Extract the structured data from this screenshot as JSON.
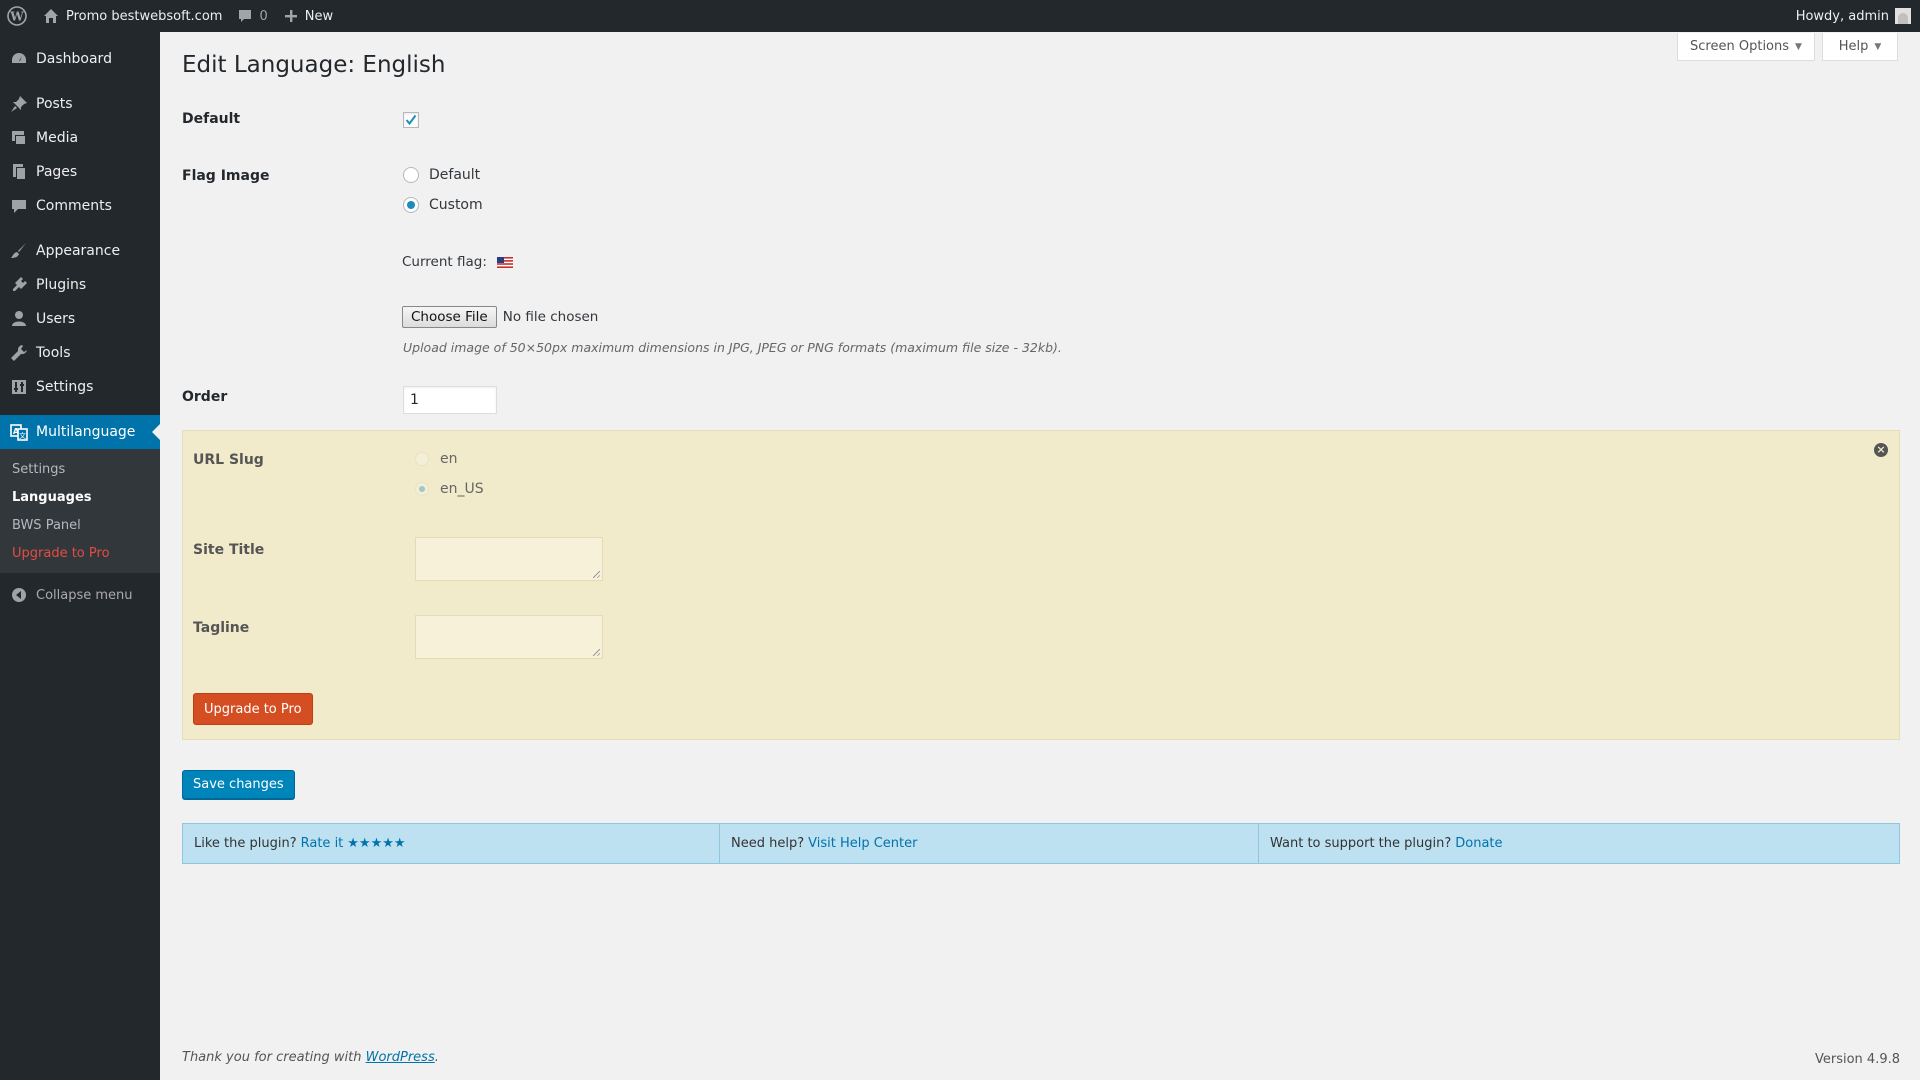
{
  "adminbar": {
    "site_name": "Promo bestwebsoft.com",
    "comments_count": "0",
    "new_label": "New",
    "account": "Howdy, admin"
  },
  "menu": {
    "items": [
      {
        "label": "Dashboard",
        "icon": "dashboard-icon"
      },
      {
        "label": "Posts",
        "icon": "pin-icon"
      },
      {
        "label": "Media",
        "icon": "media-icon"
      },
      {
        "label": "Pages",
        "icon": "pages-icon"
      },
      {
        "label": "Comments",
        "icon": "comment-icon"
      },
      {
        "label": "Appearance",
        "icon": "brush-icon"
      },
      {
        "label": "Plugins",
        "icon": "plugin-icon"
      },
      {
        "label": "Users",
        "icon": "user-icon"
      },
      {
        "label": "Tools",
        "icon": "wrench-icon"
      },
      {
        "label": "Settings",
        "icon": "settings-icon"
      },
      {
        "label": "Multilanguage",
        "icon": "translate-icon"
      }
    ],
    "submenu": [
      "Settings",
      "Languages",
      "BWS Panel",
      "Upgrade to Pro"
    ],
    "collapse": "Collapse menu"
  },
  "screen_options": "Screen Options",
  "help": "Help",
  "page_title": "Edit Language: English",
  "form": {
    "default_label": "Default",
    "default_checked": true,
    "flag_label": "Flag Image",
    "flag_options": [
      "Default",
      "Custom"
    ],
    "flag_selected": "Custom",
    "current_flag_label": "Current flag:",
    "choose_file": "Choose File",
    "no_file": "No file chosen",
    "upload_hint": "Upload image of 50×50px maximum dimensions in JPG, JPEG or PNG formats (maximum file size - 32kb).",
    "order_label": "Order",
    "order_value": "1"
  },
  "pro": {
    "url_slug_label": "URL Slug",
    "slug_options": [
      "en",
      "en_US"
    ],
    "slug_selected": "en_US",
    "site_title_label": "Site Title",
    "tagline_label": "Tagline",
    "upgrade_button": "Upgrade to Pro"
  },
  "save_button": "Save changes",
  "ratebar": {
    "like_text": "Like the plugin?",
    "rate_link": "Rate it",
    "stars": "★★★★★",
    "help_text": "Need help?",
    "help_link": "Visit Help Center",
    "support_text": "Want to support the plugin?",
    "donate_link": "Donate"
  },
  "footer": {
    "thanks": "Thank you for creating with",
    "wp_link": "WordPress",
    "period": ".",
    "version": "Version 4.9.8"
  },
  "colors": {
    "adminbar_bg": "#23282d",
    "menu_current": "#0073aa",
    "pro_box_bg": "#f1ebcb",
    "upgrade_button": "#d54e21",
    "primary_button": "#0085ba",
    "ratebar_bg": "#bee1f2",
    "upgrade_link": "#e14d43"
  }
}
